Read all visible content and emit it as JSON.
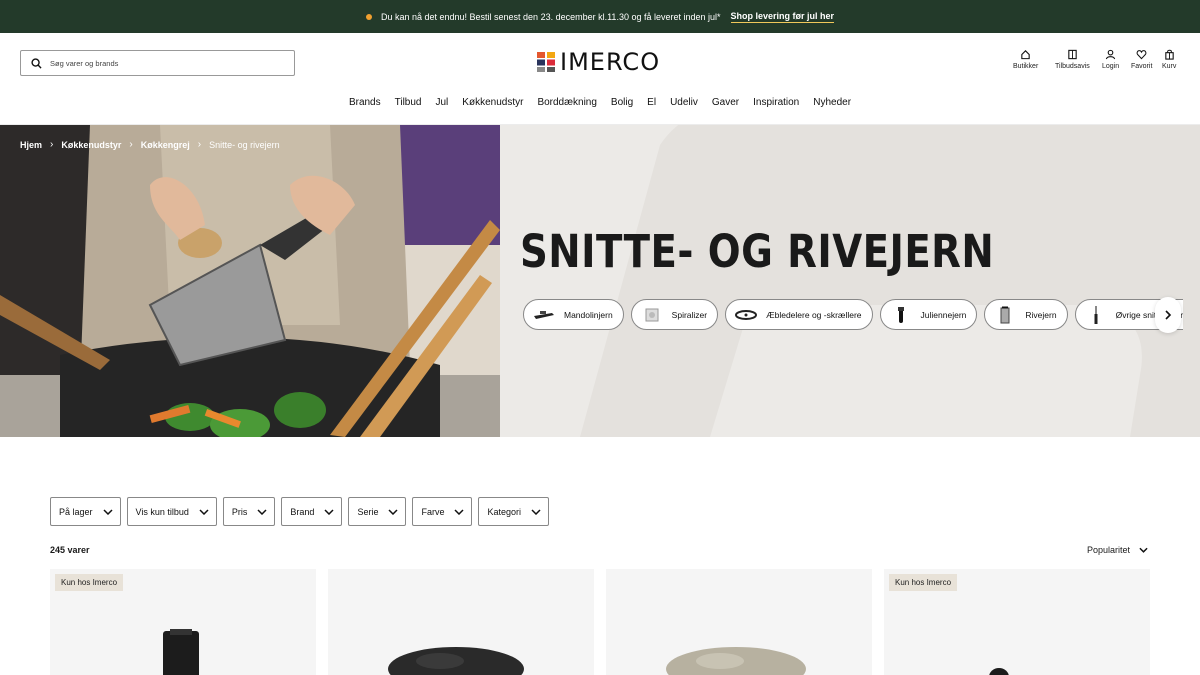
{
  "announcement": {
    "message": "Du kan nå det endnu! Bestil senest den 23. december kl.11.30 og få leveret inden jul*",
    "link": "Shop levering før jul her"
  },
  "header": {
    "search_placeholder": "Søg varer og brands",
    "logo_text": "IMERCO",
    "utilities": [
      {
        "label": "Butikker",
        "icon": "store-icon"
      },
      {
        "label": "Tilbudsavis",
        "icon": "book-icon"
      },
      {
        "label": "Login",
        "icon": "user-icon"
      },
      {
        "label": "Favorit",
        "icon": "heart-icon"
      },
      {
        "label": "Kurv",
        "icon": "cart-icon"
      }
    ]
  },
  "nav": [
    "Brands",
    "Tilbud",
    "Jul",
    "Køkkenudstyr",
    "Borddækning",
    "Bolig",
    "El",
    "Udeliv",
    "Gaver",
    "Inspiration",
    "Nyheder"
  ],
  "breadcrumb": [
    "Hjem",
    "Køkkenudstyr",
    "Køkkengrej",
    "Snitte- og rivejern"
  ],
  "hero": {
    "title": "SNITTE- OG RIVEJERN",
    "chips": [
      "Mandolinjern",
      "Spiralizer",
      "Æbledelere og -skrællere",
      "Juliennejern",
      "Rivejern",
      "Øvrige snitte- og rivejern"
    ]
  },
  "filters": [
    "På lager",
    "Vis kun tilbud",
    "Pris",
    "Brand",
    "Serie",
    "Farve",
    "Kategori"
  ],
  "results": {
    "count": "245 varer",
    "sort": "Popularitet"
  },
  "products": [
    {
      "badge": "Kun hos Imerco"
    },
    {
      "badge": ""
    },
    {
      "badge": ""
    },
    {
      "badge": "Kun hos Imerco"
    }
  ],
  "colors": {
    "topbar": "#233a2a",
    "hero_bg": "#eceae7",
    "badge_bg": "#e8e2d8"
  }
}
